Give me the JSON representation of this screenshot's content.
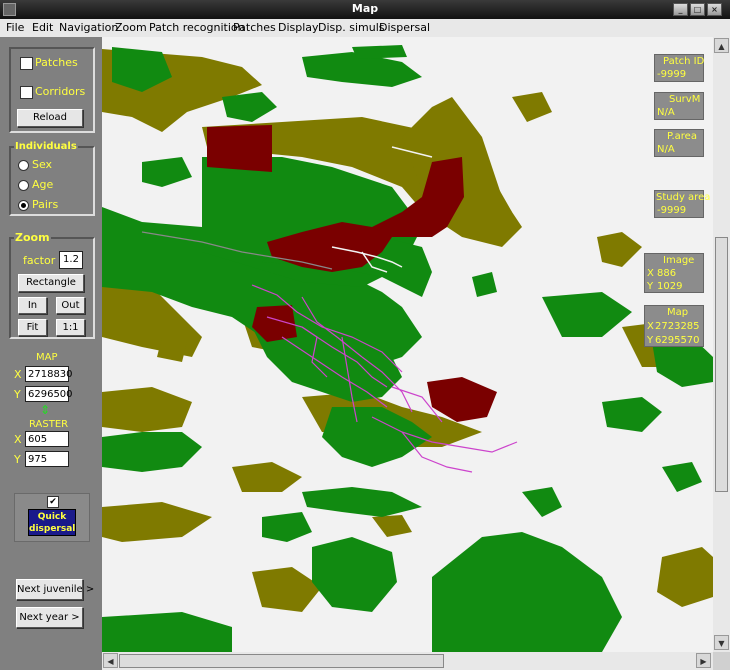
{
  "window": {
    "title": "Map",
    "controls": [
      "_",
      "□",
      "×"
    ]
  },
  "menu": [
    "File",
    "Edit",
    "Navigation",
    "Zoom",
    "Patch recognition",
    "Patches",
    "Display",
    "Disp. simuls",
    "Dispersal"
  ],
  "panel": {
    "patches_label": "Patches",
    "corridors_label": "Corridors",
    "reload_label": "Reload",
    "individuals": {
      "title": "Individuals",
      "options": [
        "Sex",
        "Age",
        "Pairs"
      ],
      "selected": "Pairs"
    },
    "zoom": {
      "title": "Zoom",
      "factor_label": "factor",
      "factor_value": "1.2",
      "rectangle_label": "Rectangle",
      "in_label": "In",
      "out_label": "Out",
      "fit_label": "Fit",
      "one_label": "1:1"
    },
    "map": {
      "title": "MAP",
      "x_label": "X",
      "x_value": "2718830",
      "y_label": "Y",
      "y_value": "6296500"
    },
    "swap_icon": "⇕",
    "raster": {
      "title": "RASTER",
      "x_label": "X",
      "x_value": "605",
      "y_label": "Y",
      "y_value": "975"
    },
    "quick": {
      "checkmark": "✔",
      "label_line1": "Quick",
      "label_line2": "dispersal"
    },
    "next_juvenile": "Next juvenile >",
    "next_year": "Next year >"
  },
  "info": {
    "patch": {
      "title": "Patch ID",
      "value": "-9999"
    },
    "survm": {
      "title": "SurvM",
      "value": "N/A"
    },
    "parea": {
      "title": "P.area",
      "value": "N/A"
    },
    "study": {
      "title": "Study area",
      "value": "-9999"
    },
    "image": {
      "title": "Image",
      "x_label": "X",
      "x": "886",
      "y_label": "Y",
      "y": "1029"
    },
    "map": {
      "title": "Map",
      "x_label": "X",
      "x": "2723285",
      "y_label": "Y",
      "y": "6295570"
    }
  },
  "colors": {
    "forest": "#118a11",
    "olive": "#7f7a00",
    "patch": "#7a0000",
    "bg": "#f2f2f2",
    "highlight": "#ffff40",
    "corridor": "#cc44cc"
  },
  "scrollbars": {
    "up": "▲",
    "down": "▼",
    "left": "◀",
    "right": "▶"
  }
}
